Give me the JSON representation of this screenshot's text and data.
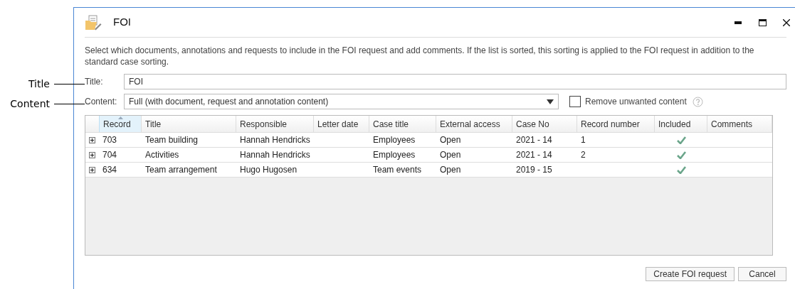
{
  "callouts": [
    "Title",
    "Content"
  ],
  "window": {
    "title": "FOI",
    "controls": [
      {
        "kind": "minimize"
      },
      {
        "kind": "maximize"
      },
      {
        "kind": "close"
      }
    ]
  },
  "description": "Select which documents, annotations and requests to include in the FOI request and add comments. If the list is sorted, this sorting is applied to the FOI request in addition to the standard case sorting.",
  "title_field": {
    "label": "Title:",
    "value": "FOI"
  },
  "content_field": {
    "label": "Content:",
    "value": "Full (with document, request and annotation content)"
  },
  "remove_unwanted": {
    "label": "Remove unwanted content",
    "checked": false
  },
  "table": {
    "columns": [
      {
        "label": "Record",
        "sorted": true
      },
      {
        "label": "Title",
        "sorted": false
      },
      {
        "label": "Responsible",
        "sorted": false
      },
      {
        "label": "Letter date",
        "sorted": false
      },
      {
        "label": "Case title",
        "sorted": false
      },
      {
        "label": "External access",
        "sorted": false
      },
      {
        "label": "Case No",
        "sorted": false
      },
      {
        "label": "Record number",
        "sorted": false
      },
      {
        "label": "Included",
        "sorted": false
      },
      {
        "label": "Comments",
        "sorted": false
      }
    ],
    "rows": [
      {
        "cells": [
          "703",
          "Team building",
          "Hannah Hendricks",
          "",
          "Employees",
          "Open",
          "2021 - 14",
          "1"
        ],
        "included": true,
        "comments": ""
      },
      {
        "cells": [
          "704",
          "Activities",
          "Hannah Hendricks",
          "",
          "Employees",
          "Open",
          "2021 - 14",
          "2"
        ],
        "included": true,
        "comments": ""
      },
      {
        "cells": [
          "634",
          "Team arrangement",
          "Hugo Hugosen",
          "",
          "Team events",
          "Open",
          "2019 - 15",
          ""
        ],
        "included": true,
        "comments": ""
      }
    ]
  },
  "buttons": [
    "Create FOI request",
    "Cancel"
  ]
}
